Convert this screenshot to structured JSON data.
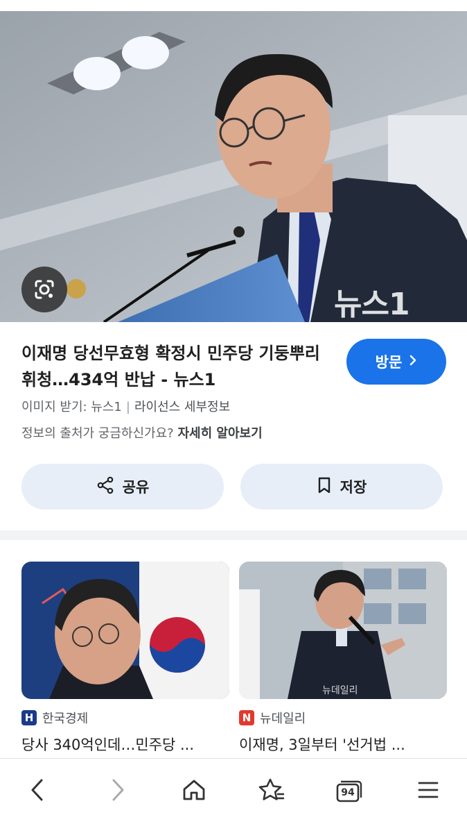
{
  "hero": {
    "watermark": "뉴스1",
    "lens_icon": "camera-lens-icon"
  },
  "result": {
    "title": "이재명 당선무효형 확정시 민주당 기둥뿌리 휘청…434억 반납 - 뉴스1",
    "visit_label": "방문",
    "image_source_label": "이미지 받기: 뉴스1",
    "license_label": "라이선스 세부정보",
    "source_question": "정보의 출처가 궁금하신가요?",
    "source_more": "자세히 알아보기",
    "share_label": "공유",
    "save_label": "저장"
  },
  "related": [
    {
      "source": "한국경제",
      "badge": "H",
      "badge_color": "#1c3a8a",
      "title": "당사 340억인데…민주당 ..."
    },
    {
      "source": "뉴데일리",
      "badge": "N",
      "badge_color": "#e03a2f",
      "title": "이재명, 3일부터 '선거법 ..."
    }
  ],
  "nav": {
    "tabs_count": "94",
    "items": [
      "back-icon",
      "forward-icon",
      "home-icon",
      "bookmark-star-icon",
      "tabs-icon",
      "menu-icon"
    ]
  },
  "colors": {
    "accent": "#1a73e8",
    "button_bg": "#e7eef8"
  }
}
